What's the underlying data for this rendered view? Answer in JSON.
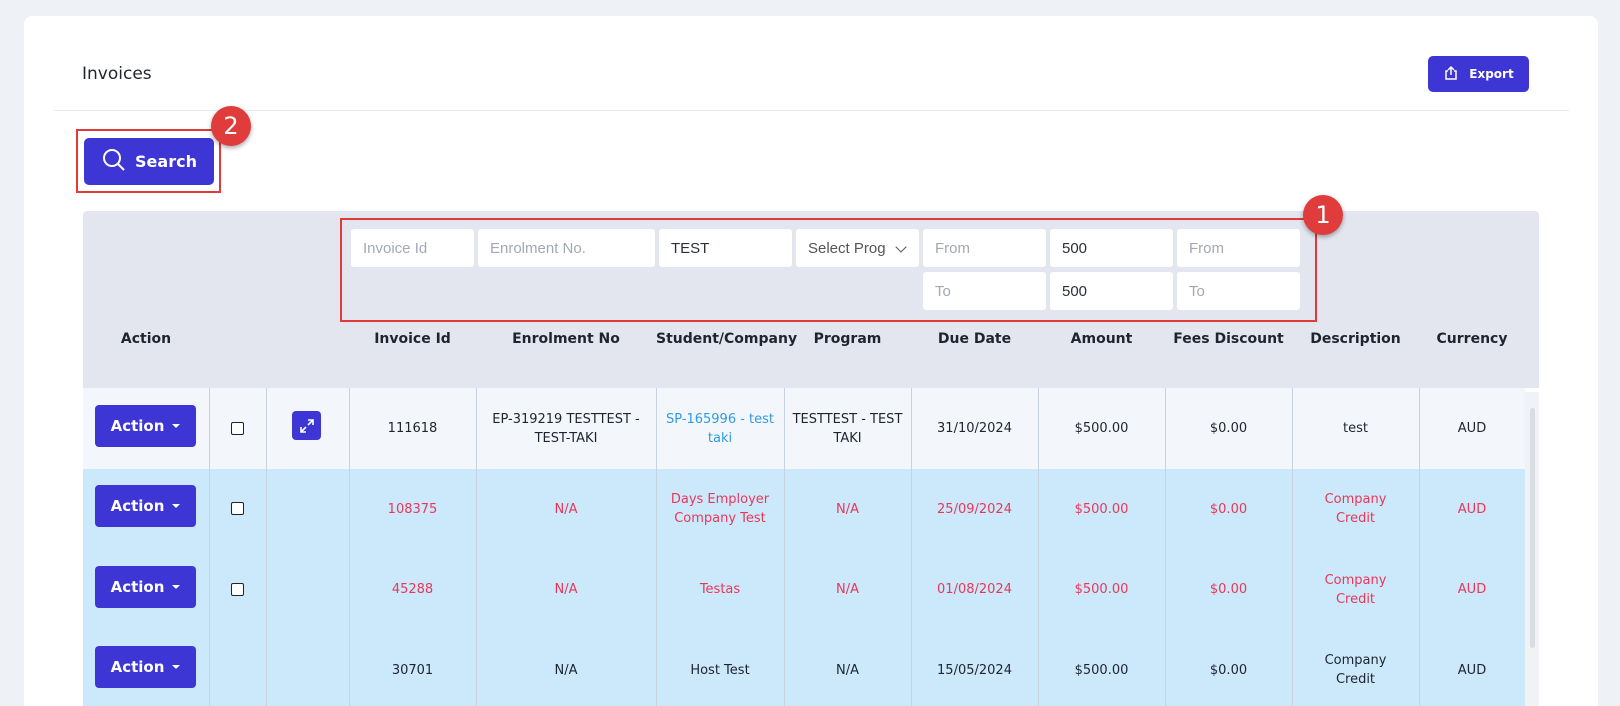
{
  "page": {
    "title": "Invoices"
  },
  "toolbar": {
    "export_label": "Export",
    "search_label": "Search"
  },
  "annotations": {
    "badge_1": "1",
    "badge_2": "2"
  },
  "filters": {
    "invoice_id": {
      "placeholder": "Invoice Id",
      "value": ""
    },
    "enrolment_no": {
      "placeholder": "Enrolment No.",
      "value": ""
    },
    "student": {
      "placeholder": "",
      "value": "TEST"
    },
    "program": {
      "selected": "Select Progr"
    },
    "due_from": {
      "placeholder": "From",
      "value": ""
    },
    "due_to": {
      "placeholder": "To",
      "value": ""
    },
    "amount_from": {
      "placeholder": "",
      "value": "500"
    },
    "amount_to": {
      "placeholder": "",
      "value": "500"
    },
    "discount_from": {
      "placeholder": "From",
      "value": ""
    },
    "discount_to": {
      "placeholder": "To",
      "value": ""
    }
  },
  "columns": {
    "action": "Action",
    "invoice_id": "Invoice Id",
    "enrolment_no": "Enrolment No",
    "student": "Student/Company",
    "program": "Program",
    "due_date": "Due Date",
    "amount": "Amount",
    "fees_discount": "Fees Discount",
    "description": "Description",
    "currency": "Currency"
  },
  "rows": [
    {
      "action": "Action",
      "invoice_id": "111618",
      "enrolment_no": "EP-319219 TESTTEST - TEST-TAKI",
      "student": "SP-165996 - test taki",
      "program": "TESTTEST - TEST TAKI",
      "due_date": "31/10/2024",
      "amount": "$500.00",
      "fees_discount": "$0.00",
      "description": "test",
      "currency": "AUD"
    },
    {
      "action": "Action",
      "invoice_id": "108375",
      "enrolment_no": "N/A",
      "student": "Days Employer Company Test",
      "program": "N/A",
      "due_date": "25/09/2024",
      "amount": "$500.00",
      "fees_discount": "$0.00",
      "description": "Company Credit",
      "currency": "AUD"
    },
    {
      "action": "Action",
      "invoice_id": "45288",
      "enrolment_no": "N/A",
      "student": "Testas",
      "program": "N/A",
      "due_date": "01/08/2024",
      "amount": "$500.00",
      "fees_discount": "$0.00",
      "description": "Company Credit",
      "currency": "AUD"
    },
    {
      "action": "Action",
      "invoice_id": "30701",
      "enrolment_no": "N/A",
      "student": "Host Test",
      "program": "N/A",
      "due_date": "15/05/2024",
      "amount": "$500.00",
      "fees_discount": "$0.00",
      "description": "Company Credit",
      "currency": "AUD"
    }
  ],
  "colors": {
    "primary": "#3d35d4",
    "highlight": "#e03a3a",
    "overdue_text": "#e8385a",
    "link": "#2f9be0",
    "row_blue": "#cbe9fb"
  }
}
